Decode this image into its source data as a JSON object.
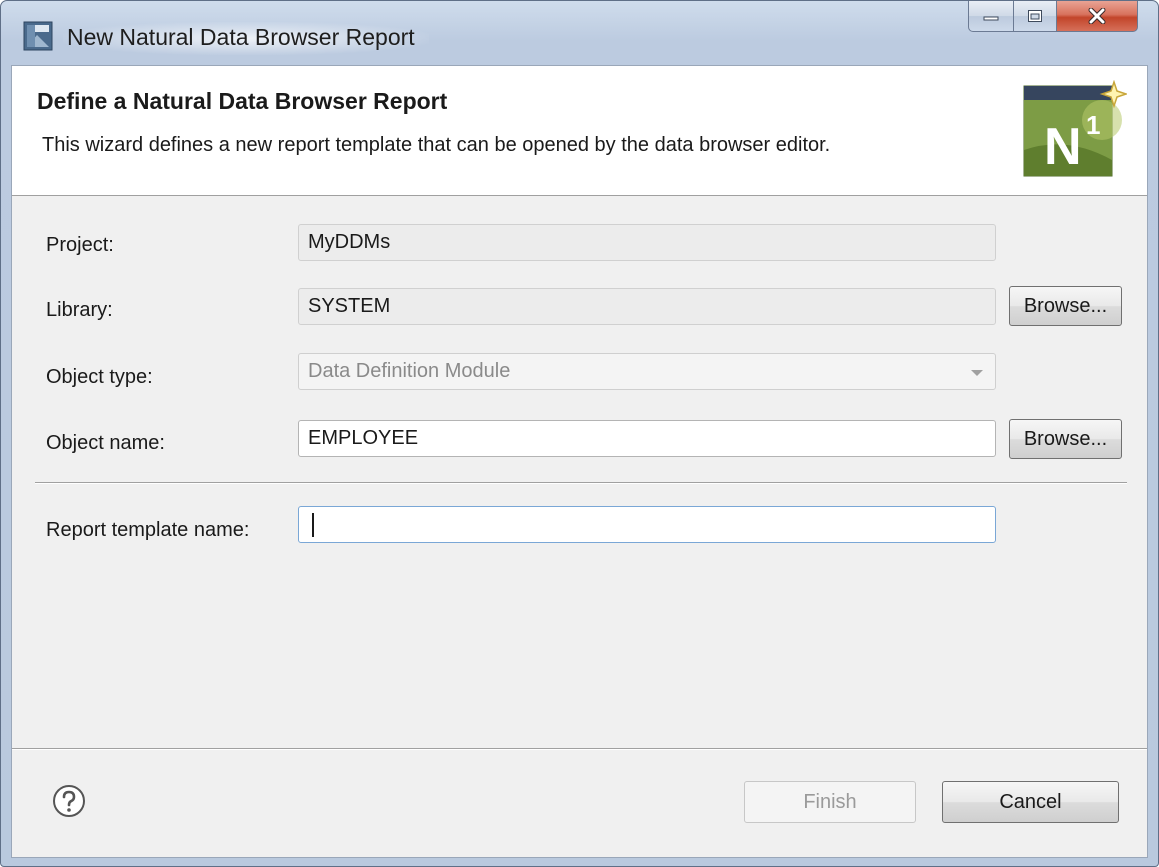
{
  "window": {
    "title": "New Natural Data Browser Report"
  },
  "header": {
    "title": "Define a Natural Data Browser Report",
    "description": "This wizard defines a new report template that can be opened by the data browser editor.",
    "icon_text": "N",
    "icon_superscript": "1"
  },
  "form": {
    "project": {
      "label": "Project:",
      "value": "MyDDMs"
    },
    "library": {
      "label": "Library:",
      "value": "SYSTEM",
      "browse_label": "Browse..."
    },
    "object_type": {
      "label": "Object type:",
      "value": "Data Definition Module"
    },
    "object_name": {
      "label": "Object name:",
      "value": "EMPLOYEE",
      "browse_label": "Browse..."
    },
    "report_template": {
      "label": "Report template name:",
      "value": ""
    }
  },
  "buttons": {
    "finish": "Finish",
    "cancel": "Cancel"
  },
  "colors": {
    "close_button": "#c2452a",
    "dialog_bg": "#f0f0f0",
    "focus_border": "#7aa7d6"
  }
}
